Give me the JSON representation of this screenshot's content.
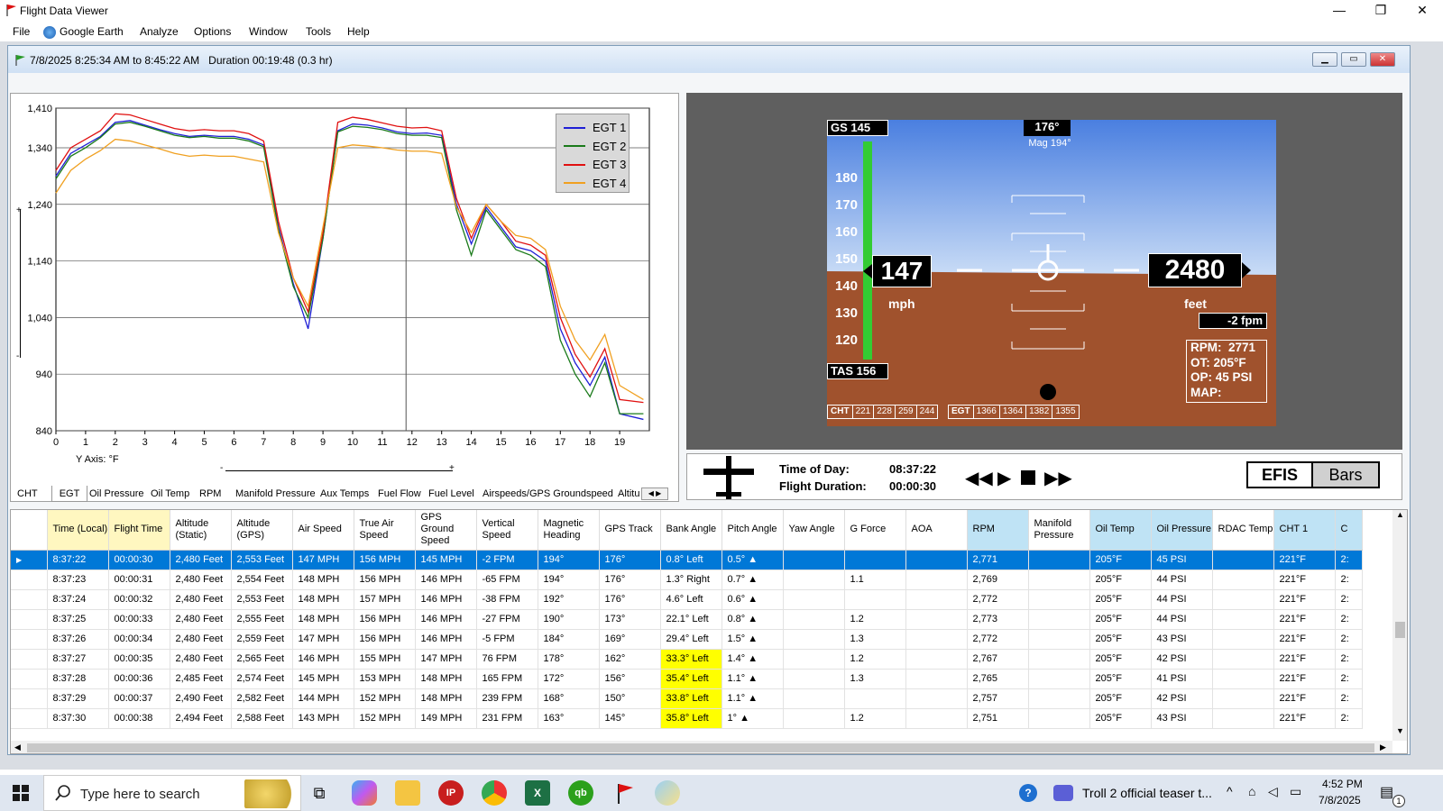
{
  "window": {
    "title": "Flight Data Viewer"
  },
  "menu": [
    "File",
    "Google Earth",
    "Analyze",
    "Options",
    "Window",
    "Tools",
    "Help"
  ],
  "flight": {
    "time_range": "7/8/2025 8:25:34 AM to 8:45:22 AM",
    "duration": "Duration 00:19:48 (0.3 hr)"
  },
  "chart": {
    "y_axis_note": "Y Axis: °F",
    "legend": [
      "EGT 1",
      "EGT 2",
      "EGT 3",
      "EGT 4"
    ],
    "colors": [
      "#1f1fd6",
      "#1a7a1a",
      "#e01010",
      "#f0a020"
    ]
  },
  "chart_data": {
    "type": "line",
    "xlabel": "",
    "ylabel": "",
    "xlim": [
      0,
      20
    ],
    "ylim": [
      840,
      1410
    ],
    "x_ticks": [
      0,
      1,
      2,
      3,
      4,
      5,
      6,
      7,
      8,
      9,
      10,
      11,
      12,
      13,
      14,
      15,
      16,
      17,
      18,
      19
    ],
    "y_ticks": [
      840,
      940,
      1040,
      1140,
      1240,
      1340,
      1410
    ],
    "y_tick_labels": [
      "840",
      "940",
      "1,040",
      "1,140",
      "1,240",
      "1,340",
      "1,410"
    ],
    "x": [
      0,
      0.5,
      1,
      1.5,
      2,
      2.5,
      3,
      3.5,
      4,
      4.5,
      5,
      5.5,
      6,
      6.5,
      7,
      7.5,
      8,
      8.5,
      9,
      9.5,
      10,
      10.5,
      11,
      11.5,
      12,
      12.5,
      13,
      13.5,
      14,
      14.5,
      15,
      15.5,
      16,
      16.5,
      17,
      17.5,
      18,
      18.5,
      19,
      19.8
    ],
    "series": [
      {
        "name": "EGT 1",
        "values": [
          1290,
          1330,
          1345,
          1360,
          1385,
          1388,
          1380,
          1372,
          1365,
          1360,
          1362,
          1360,
          1360,
          1355,
          1345,
          1200,
          1100,
          1020,
          1180,
          1370,
          1382,
          1380,
          1375,
          1368,
          1365,
          1366,
          1362,
          1240,
          1170,
          1235,
          1200,
          1165,
          1158,
          1140,
          1020,
          960,
          920,
          970,
          870,
          860
        ]
      },
      {
        "name": "EGT 2",
        "values": [
          1285,
          1325,
          1340,
          1358,
          1382,
          1385,
          1378,
          1370,
          1362,
          1358,
          1360,
          1357,
          1357,
          1352,
          1342,
          1195,
          1095,
          1040,
          1180,
          1368,
          1378,
          1376,
          1372,
          1365,
          1362,
          1362,
          1358,
          1230,
          1150,
          1230,
          1195,
          1160,
          1150,
          1130,
          1000,
          940,
          900,
          960,
          870,
          870
        ]
      },
      {
        "name": "EGT 3",
        "values": [
          1300,
          1340,
          1355,
          1370,
          1400,
          1398,
          1390,
          1382,
          1374,
          1370,
          1372,
          1370,
          1370,
          1365,
          1352,
          1210,
          1110,
          1050,
          1190,
          1385,
          1394,
          1390,
          1384,
          1378,
          1375,
          1376,
          1370,
          1250,
          1180,
          1240,
          1210,
          1175,
          1168,
          1150,
          1040,
          975,
          935,
          985,
          895,
          890
        ]
      },
      {
        "name": "EGT 4",
        "values": [
          1260,
          1300,
          1320,
          1335,
          1355,
          1352,
          1345,
          1338,
          1330,
          1325,
          1327,
          1325,
          1325,
          1320,
          1315,
          1190,
          1110,
          1060,
          1200,
          1340,
          1345,
          1343,
          1340,
          1336,
          1334,
          1334,
          1330,
          1235,
          1190,
          1240,
          1210,
          1185,
          1180,
          1160,
          1060,
          1000,
          965,
          1010,
          920,
          895
        ]
      }
    ]
  },
  "chart_tabs": [
    "CHT",
    "EGT",
    "Oil Pressure",
    "Oil Temp",
    "RPM",
    "Manifold Pressure",
    "Aux Temps",
    "Fuel Flow",
    "Fuel Level",
    "Airspeeds/GPS Groundspeed",
    "Altitu"
  ],
  "efis": {
    "gs": "GS 145",
    "track": "176°",
    "mag": "Mag 194°",
    "speed_scale": [
      "180",
      "170",
      "160",
      "150",
      "140",
      "130",
      "120"
    ],
    "airspeed": "147",
    "airspeed_unit": "mph",
    "altitude": "2480",
    "altitude_unit": "feet",
    "vsi": "-2 fpm",
    "tas": "TAS 156",
    "engine": [
      "RPM:  2771",
      "OT: 205°F",
      "OP: 45 PSI",
      "MAP:"
    ],
    "cht_label": "CHT",
    "cht_values": [
      "221",
      "228",
      "259",
      "244"
    ],
    "egt_label": "EGT",
    "egt_values": [
      "1366",
      "1364",
      "1382",
      "1355"
    ]
  },
  "controls": {
    "time_of_day_label": "Time of Day:",
    "time_of_day": "08:37:22",
    "duration_label": "Flight Duration:",
    "duration": "00:00:30",
    "efis_btn": "EFIS",
    "bars_btn": "Bars"
  },
  "table": {
    "headers": [
      {
        "l": "Time (Local)",
        "c": "hy"
      },
      {
        "l": "Flight Time",
        "c": "hy"
      },
      {
        "l": "Altitude (Static)",
        "c": ""
      },
      {
        "l": "Altitude (GPS)",
        "c": ""
      },
      {
        "l": "Air Speed",
        "c": ""
      },
      {
        "l": "True Air Speed",
        "c": ""
      },
      {
        "l": "GPS Ground Speed",
        "c": ""
      },
      {
        "l": "Vertical Speed",
        "c": ""
      },
      {
        "l": "Magnetic Heading",
        "c": ""
      },
      {
        "l": "GPS Track",
        "c": ""
      },
      {
        "l": "Bank Angle",
        "c": ""
      },
      {
        "l": "Pitch Angle",
        "c": ""
      },
      {
        "l": "Yaw Angle",
        "c": ""
      },
      {
        "l": "G Force",
        "c": ""
      },
      {
        "l": "AOA",
        "c": ""
      },
      {
        "l": "RPM",
        "c": "hb"
      },
      {
        "l": "Manifold Pressure",
        "c": ""
      },
      {
        "l": "Oil Temp",
        "c": "hb"
      },
      {
        "l": "Oil Pressure",
        "c": "hb"
      },
      {
        "l": "RDAC Temp",
        "c": ""
      },
      {
        "l": "CHT 1",
        "c": "hb"
      },
      {
        "l": "C",
        "c": "hb"
      }
    ],
    "rows": [
      [
        "8:37:22",
        "00:00:30",
        "2,480 Feet",
        "2,553 Feet",
        "147 MPH",
        "156 MPH",
        "145 MPH",
        "-2 FPM",
        "194°",
        "176°",
        "0.8° Left",
        "0.5° ▲",
        "",
        "",
        "",
        "2,771",
        "",
        "205°F",
        "45 PSI",
        "",
        "221°F",
        "2:"
      ],
      [
        "8:37:23",
        "00:00:31",
        "2,480 Feet",
        "2,554 Feet",
        "148 MPH",
        "156 MPH",
        "146 MPH",
        "-65 FPM",
        "194°",
        "176°",
        "1.3° Right",
        "0.7° ▲",
        "",
        "1.1",
        "",
        "2,769",
        "",
        "205°F",
        "44 PSI",
        "",
        "221°F",
        "2:"
      ],
      [
        "8:37:24",
        "00:00:32",
        "2,480 Feet",
        "2,553 Feet",
        "148 MPH",
        "157 MPH",
        "146 MPH",
        "-38 FPM",
        "192°",
        "176°",
        "4.6° Left",
        "0.6° ▲",
        "",
        "",
        "",
        "2,772",
        "",
        "205°F",
        "44 PSI",
        "",
        "221°F",
        "2:"
      ],
      [
        "8:37:25",
        "00:00:33",
        "2,480 Feet",
        "2,555 Feet",
        "148 MPH",
        "156 MPH",
        "146 MPH",
        "-27 FPM",
        "190°",
        "173°",
        "22.1° Left",
        "0.8° ▲",
        "",
        "1.2",
        "",
        "2,773",
        "",
        "205°F",
        "44 PSI",
        "",
        "221°F",
        "2:"
      ],
      [
        "8:37:26",
        "00:00:34",
        "2,480 Feet",
        "2,559 Feet",
        "147 MPH",
        "156 MPH",
        "146 MPH",
        "-5 FPM",
        "184°",
        "169°",
        "29.4° Left",
        "1.5° ▲",
        "",
        "1.3",
        "",
        "2,772",
        "",
        "205°F",
        "43 PSI",
        "",
        "221°F",
        "2:"
      ],
      [
        "8:37:27",
        "00:00:35",
        "2,480 Feet",
        "2,565 Feet",
        "146 MPH",
        "155 MPH",
        "147 MPH",
        "76 FPM",
        "178°",
        "162°",
        "33.3° Left",
        "1.4° ▲",
        "",
        "1.2",
        "",
        "2,767",
        "",
        "205°F",
        "42 PSI",
        "",
        "221°F",
        "2:"
      ],
      [
        "8:37:28",
        "00:00:36",
        "2,485 Feet",
        "2,574 Feet",
        "145 MPH",
        "153 MPH",
        "148 MPH",
        "165 FPM",
        "172°",
        "156°",
        "35.4° Left",
        "1.1° ▲",
        "",
        "1.3",
        "",
        "2,765",
        "",
        "205°F",
        "41 PSI",
        "",
        "221°F",
        "2:"
      ],
      [
        "8:37:29",
        "00:00:37",
        "2,490 Feet",
        "2,582 Feet",
        "144 MPH",
        "152 MPH",
        "148 MPH",
        "239 FPM",
        "168°",
        "150°",
        "33.8° Left",
        "1.1° ▲",
        "",
        "",
        "",
        "2,757",
        "",
        "205°F",
        "42 PSI",
        "",
        "221°F",
        "2:"
      ],
      [
        "8:37:30",
        "00:00:38",
        "2,494 Feet",
        "2,588 Feet",
        "143 MPH",
        "152 MPH",
        "149 MPH",
        "231 FPM",
        "163°",
        "145°",
        "35.8° Left",
        "1° ▲",
        "",
        "1.2",
        "",
        "2,751",
        "",
        "205°F",
        "43 PSI",
        "",
        "221°F",
        "2:"
      ]
    ],
    "warn_rows": [
      5,
      6,
      7,
      8
    ]
  },
  "taskbar": {
    "search_placeholder": "Type here to search",
    "notification": "Troll 2 official teaser t...",
    "time": "4:52 PM",
    "date": "7/8/2025",
    "badge": "1"
  }
}
